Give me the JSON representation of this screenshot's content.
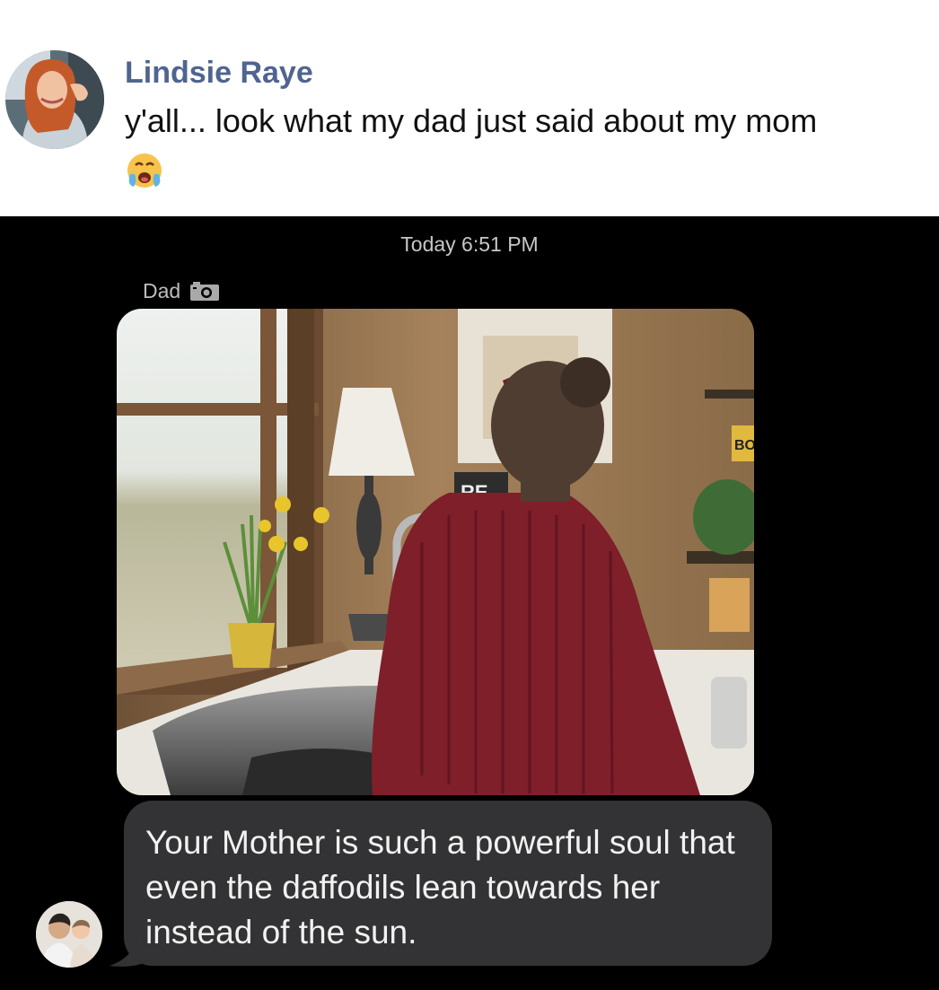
{
  "post": {
    "author_name": "Lindsie Raye",
    "text": "y'all... look what my dad just said about my mom",
    "emoji": "crying-face-emoji"
  },
  "messages": {
    "timestamp": "Today 6:51 PM",
    "sender_name": "Dad",
    "sender_icon": "camera-icon",
    "photo_sign_text": "RE",
    "photo_shelf_text": "BO",
    "message_text": "Your Mother is such a powerful soul that even the daffodils lean towards her instead of the sun."
  },
  "colors": {
    "author_name": "#4f6590",
    "screenshot_background": "#000000",
    "bubble_background": "#333335",
    "sweater": "#7e1f2a"
  }
}
